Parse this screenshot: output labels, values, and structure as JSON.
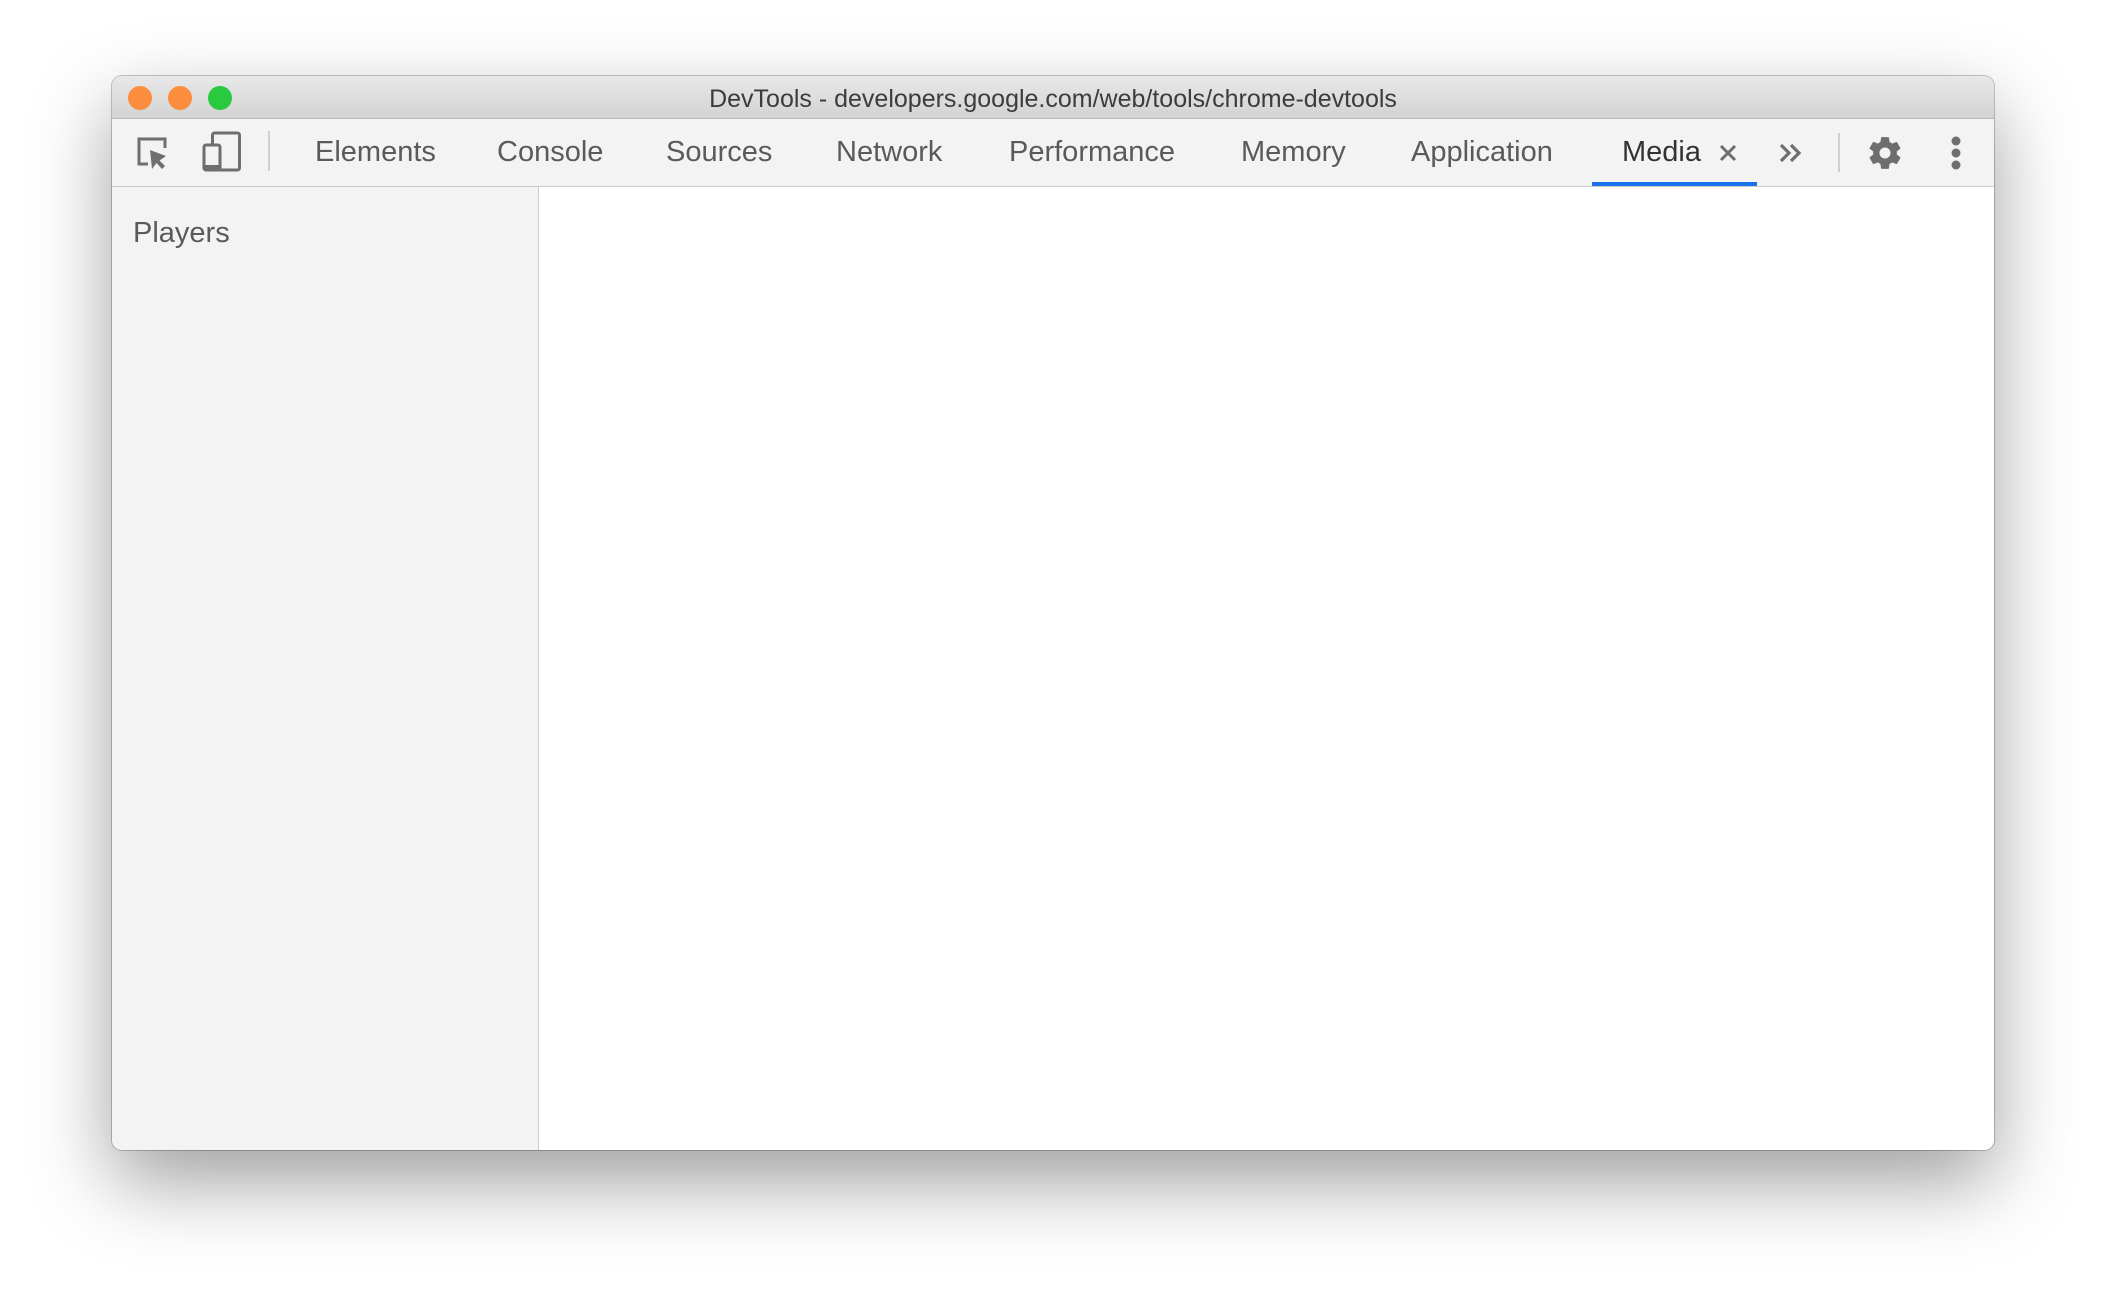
{
  "window": {
    "title": "DevTools - developers.google.com/web/tools/chrome-devtools",
    "traffic_lights": {
      "close_color": "#fc8c3e",
      "minimize_color": "#fc8c3e",
      "maximize_color": "#29c940"
    }
  },
  "toolbar": {
    "inspect_icon": "inspect-element-icon",
    "device_icon": "device-toolbar-icon",
    "tabs": [
      {
        "label": "Elements",
        "active": false
      },
      {
        "label": "Console",
        "active": false
      },
      {
        "label": "Sources",
        "active": false
      },
      {
        "label": "Network",
        "active": false
      },
      {
        "label": "Performance",
        "active": false
      },
      {
        "label": "Memory",
        "active": false
      },
      {
        "label": "Application",
        "active": false
      },
      {
        "label": "Media",
        "active": true,
        "closable": true
      }
    ],
    "more_tabs_icon": "double-chevron-right-icon",
    "settings_icon": "gear-icon",
    "menu_icon": "vertical-dots-icon",
    "accent_color": "#1a73e8",
    "icon_color": "#6e6e6e"
  },
  "sidebar": {
    "title": "Players"
  }
}
